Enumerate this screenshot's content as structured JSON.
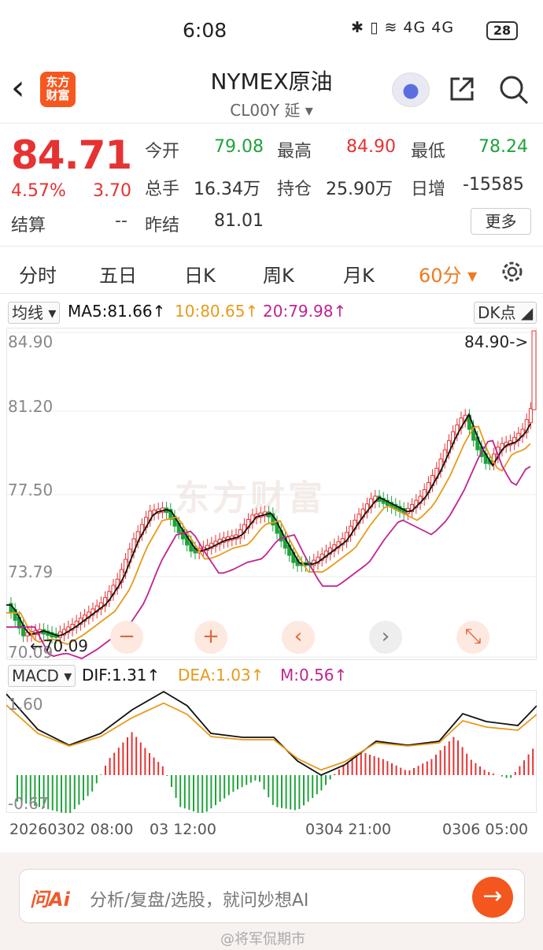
{
  "status_bar": {
    "time": "6:08",
    "icons": "✱ ▯ ≋ 4G 4G",
    "battery": "28"
  },
  "header": {
    "logo_text": "东方\n财富",
    "title": "NYMEX原油",
    "subtitle": "CL00Y 延 ▾"
  },
  "quote": {
    "price": "84.71",
    "pct_change": "4.57%",
    "change": "3.70",
    "settle_label": "结算",
    "settle_value": "--",
    "open_label": "今开",
    "open_value": "79.08",
    "high_label": "最高",
    "high_value": "84.90",
    "low_label": "最低",
    "low_value": "78.24",
    "volume_label": "总手",
    "volume_value": "16.34万",
    "oi_label": "持仓",
    "oi_value": "25.90万",
    "daily_inc_label": "日增",
    "daily_inc_value": "-15585",
    "prev_settle_label": "昨结",
    "prev_settle_value": "81.01",
    "more_label": "更多"
  },
  "tabs": [
    "分时",
    "五日",
    "日K",
    "周K",
    "月K",
    "60分 ▾"
  ],
  "indicators": {
    "ma_select": "均线 ▾",
    "ma5": "MA5:81.66↑",
    "ma10": "10:80.65↑",
    "ma20": "20:79.98↑",
    "dk": "DK点 ◢",
    "high_marker": "84.90->",
    "low_marker": "←70.09",
    "macd_select": "MACD ▾",
    "dif": "DIF:1.31↑",
    "dea": "DEA:1.03↑",
    "m": "M:0.56↑"
  },
  "price_axis": [
    "84.90",
    "81.20",
    "77.50",
    "73.79",
    "70.09"
  ],
  "macd_axis": [
    "1.60",
    "-0.67"
  ],
  "time_axis": [
    "20260302 08:00",
    "03 12:00",
    "0304 21:00",
    "0306 05:00"
  ],
  "nav_buttons": [
    "−",
    "+",
    "‹",
    "›",
    "⤡"
  ],
  "ai": {
    "logo": "问Ai",
    "placeholder": "分析/复盘/选股，就问妙想AI",
    "send": "→"
  },
  "watermark": "东方财富",
  "weibo_watermark": "@将军侃期市",
  "colors": {
    "up": "#e63232",
    "down": "#1fa33a",
    "ma5": "#111111",
    "ma10": "#e89a1a",
    "ma20": "#c0248f",
    "accent": "#f07a1e"
  },
  "chart_data": {
    "type": "candlestick",
    "interval": "60分",
    "ylim": [
      70.09,
      84.9
    ],
    "ma_series": [
      {
        "name": "MA5",
        "last": 81.66
      },
      {
        "name": "10",
        "last": 80.65
      },
      {
        "name": "20",
        "last": 79.98
      }
    ],
    "macd": {
      "dif": 1.31,
      "dea": 1.03,
      "m": 0.56,
      "ylim": [
        -0.67,
        1.6
      ]
    }
  }
}
